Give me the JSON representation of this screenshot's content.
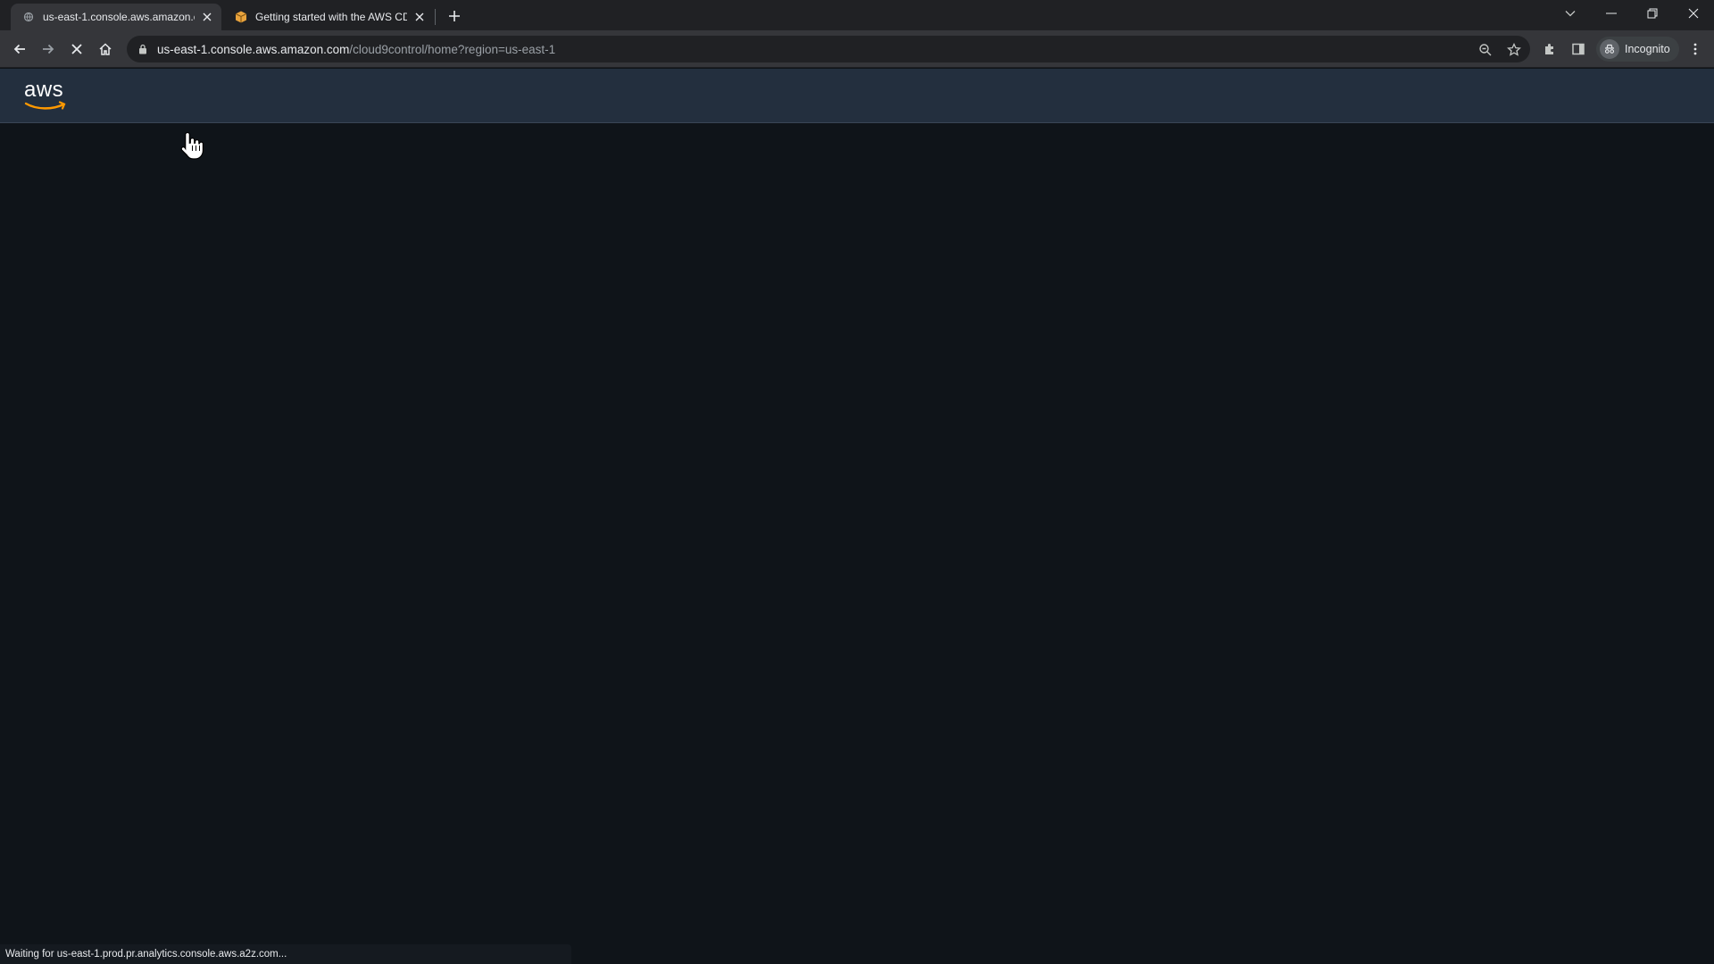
{
  "browser": {
    "tabs": [
      {
        "title": "us-east-1.console.aws.amazon.cc",
        "icon": "loading-globe-icon",
        "active": true
      },
      {
        "title": "Getting started with the AWS CD",
        "icon": "aws-box-icon",
        "active": false
      }
    ],
    "new_tab_icon": "plus-icon",
    "window_controls": [
      "tab-search-icon",
      "minimize-icon",
      "restore-icon",
      "close-icon"
    ],
    "nav": {
      "back": "back-arrow-icon",
      "forward": "forward-arrow-icon",
      "stop": "stop-x-icon",
      "home": "home-icon"
    },
    "address_bar": {
      "host": "us-east-1.console.aws.amazon.com",
      "path": "/cloud9control/home?region=us-east-1"
    },
    "toolbar_icons": [
      "zoom-icon",
      "bookmark-star-icon",
      "extensions-puzzle-icon",
      "side-panel-icon",
      "menu-kebab-icon"
    ],
    "profile_label": "Incognito"
  },
  "aws_header": {
    "logo_text": "aws",
    "background": "#232f3e",
    "smile_color": "#ff9900"
  },
  "status": {
    "text": "Waiting for us-east-1.prod.pr.analytics.console.aws.a2z.com..."
  }
}
